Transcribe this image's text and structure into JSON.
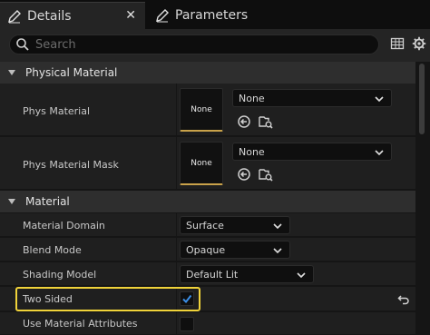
{
  "tabs": [
    {
      "label": "Details",
      "icon": "pencil-icon",
      "active": true
    },
    {
      "label": "Parameters",
      "icon": "pencil-icon",
      "active": false
    }
  ],
  "tab_close": "✕",
  "search": {
    "placeholder": "Search",
    "value": ""
  },
  "toolbar": {
    "icons": [
      "table-icon",
      "gear-icon"
    ]
  },
  "sections": {
    "physical_material": {
      "title": "Physical Material",
      "rows": [
        {
          "label": "Phys Material",
          "thumb": "None",
          "value": "None"
        },
        {
          "label": "Phys Material Mask",
          "thumb": "None",
          "value": "None"
        }
      ]
    },
    "material": {
      "title": "Material",
      "rows": [
        {
          "label": "Material Domain",
          "value": "Surface"
        },
        {
          "label": "Blend Mode",
          "value": "Opaque"
        },
        {
          "label": "Shading Model",
          "value": "Default Lit"
        },
        {
          "label": "Two Sided",
          "checked": true
        },
        {
          "label": "Use Material Attributes",
          "checked": false
        }
      ]
    }
  },
  "colors": {
    "highlight": "#f0d33a",
    "accent": "#c9a24a",
    "check": "#3a8ee6"
  }
}
